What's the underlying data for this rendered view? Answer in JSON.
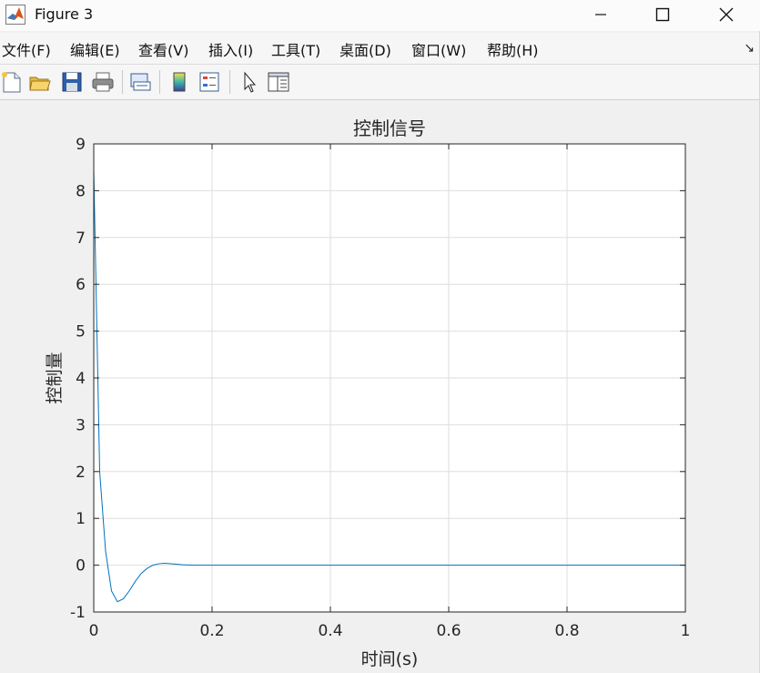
{
  "window": {
    "title": "Figure 3"
  },
  "menu": [
    "文件(F)",
    "编辑(E)",
    "查看(V)",
    "插入(I)",
    "工具(T)",
    "桌面(D)",
    "窗口(W)",
    "帮助(H)"
  ],
  "toolbar": [
    "new-figure-icon",
    "open-file-icon",
    "save-icon",
    "print-icon",
    "link-plot-icon",
    "insert-colorbar-icon",
    "insert-legend-icon",
    "edit-plot-icon",
    "property-inspector-icon"
  ],
  "chart_data": {
    "type": "line",
    "title": "控制信号",
    "xlabel": "时间(s)",
    "ylabel": "控制量",
    "xlim": [
      0,
      1
    ],
    "ylim": [
      -1,
      9
    ],
    "xticks": [
      0,
      0.2,
      0.4,
      0.6,
      0.8,
      1
    ],
    "yticks": [
      -1,
      0,
      1,
      2,
      3,
      4,
      5,
      6,
      7,
      8,
      9
    ],
    "grid": true,
    "line_color": "#0072bd",
    "series": [
      {
        "x": [
          0,
          0.01,
          0.02,
          0.03,
          0.04,
          0.05,
          0.06,
          0.07,
          0.08,
          0.09,
          0.1,
          0.11,
          0.12,
          0.13,
          0.15,
          0.17,
          0.2,
          0.3,
          0.5,
          0.7,
          1.0
        ],
        "y": [
          8.45,
          2.0,
          0.3,
          -0.55,
          -0.78,
          -0.72,
          -0.55,
          -0.35,
          -0.18,
          -0.07,
          0.0,
          0.03,
          0.04,
          0.03,
          0.01,
          0.0,
          0.0,
          0.0,
          0.0,
          0.0,
          0.0
        ]
      }
    ]
  }
}
